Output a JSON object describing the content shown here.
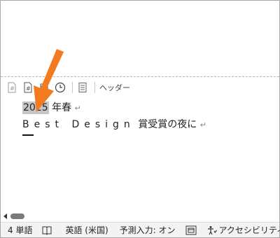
{
  "header_toolbar": {
    "icons": [
      "page-number-icon",
      "page-count-icon",
      "date-icon",
      "time-icon",
      "header-preview-icon"
    ],
    "label": "ヘッダー"
  },
  "document": {
    "line1": {
      "selected": "2025",
      "rest": "年春",
      "mark": "↵"
    },
    "line2": {
      "spaced": "Best Design",
      "rest": "賞受賞の夜に",
      "mark": "↵"
    }
  },
  "status_bar": {
    "word_count": "4 単語",
    "language": "英語 (米国)",
    "predict": "予測入力: オン",
    "accessibility": "アクセシビリティ:"
  },
  "colors": {
    "arrow": "#f47a20",
    "selection": "#c6c6c6"
  }
}
